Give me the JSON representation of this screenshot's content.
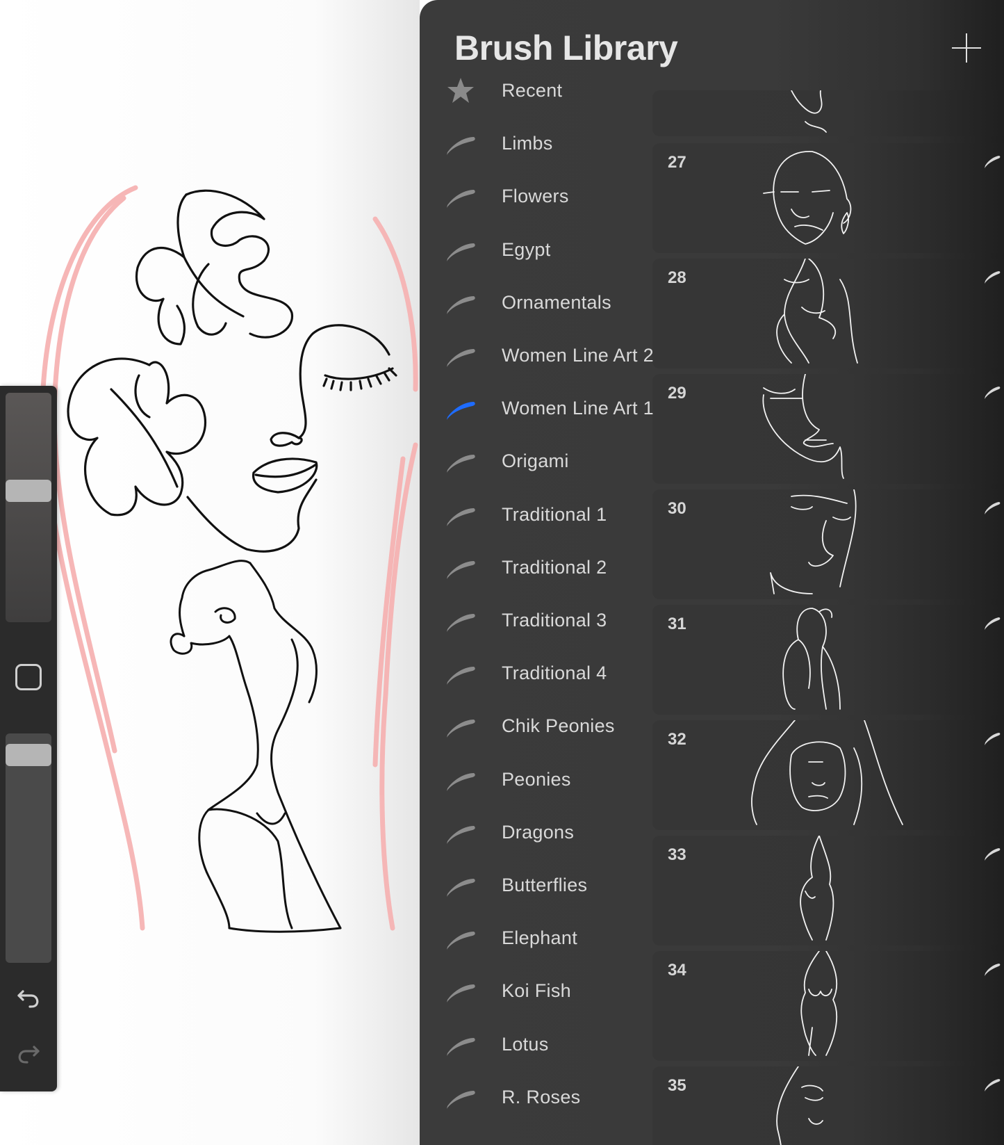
{
  "panel": {
    "title": "Brush Library",
    "add_icon": "plus-icon"
  },
  "sidebar": {
    "size_slider_level": 0.58,
    "opacity_slider_level": 0.95,
    "modify_icon": "square-icon",
    "undo_icon": "undo-arrow-icon",
    "redo_icon": "redo-arrow-icon"
  },
  "brush_sets": [
    {
      "label": "Recent",
      "icon": "star-icon",
      "selected": false
    },
    {
      "label": "Limbs",
      "icon": "brush-stroke-icon",
      "selected": false
    },
    {
      "label": "Flowers",
      "icon": "brush-stroke-icon",
      "selected": false
    },
    {
      "label": "Egypt",
      "icon": "brush-stroke-icon",
      "selected": false
    },
    {
      "label": "Ornamentals",
      "icon": "brush-stroke-icon",
      "selected": false
    },
    {
      "label": "Women Line Art 2",
      "icon": "brush-stroke-icon",
      "selected": false
    },
    {
      "label": "Women Line Art 1",
      "icon": "brush-stroke-icon",
      "selected": true
    },
    {
      "label": "Origami",
      "icon": "brush-stroke-icon",
      "selected": false
    },
    {
      "label": "Traditional 1",
      "icon": "brush-stroke-icon",
      "selected": false
    },
    {
      "label": "Traditional 2",
      "icon": "brush-stroke-icon",
      "selected": false
    },
    {
      "label": "Traditional 3",
      "icon": "brush-stroke-icon",
      "selected": false
    },
    {
      "label": "Traditional 4",
      "icon": "brush-stroke-icon",
      "selected": false
    },
    {
      "label": "Chik Peonies",
      "icon": "brush-stroke-icon",
      "selected": false
    },
    {
      "label": "Peonies",
      "icon": "brush-stroke-icon",
      "selected": false
    },
    {
      "label": "Dragons",
      "icon": "brush-stroke-icon",
      "selected": false
    },
    {
      "label": "Butterflies",
      "icon": "brush-stroke-icon",
      "selected": false
    },
    {
      "label": "Elephant",
      "icon": "brush-stroke-icon",
      "selected": false
    },
    {
      "label": "Koi Fish",
      "icon": "brush-stroke-icon",
      "selected": false
    },
    {
      "label": "Lotus",
      "icon": "brush-stroke-icon",
      "selected": false
    },
    {
      "label": "R. Roses",
      "icon": "brush-stroke-icon",
      "selected": false
    }
  ],
  "brushes": [
    {
      "number": "",
      "preview": "face-line-art-preview"
    },
    {
      "number": "27",
      "preview": "face-line-art-preview"
    },
    {
      "number": "28",
      "preview": "face-line-art-preview"
    },
    {
      "number": "29",
      "preview": "face-line-art-preview"
    },
    {
      "number": "30",
      "preview": "face-line-art-preview"
    },
    {
      "number": "31",
      "preview": "figure-line-art-preview"
    },
    {
      "number": "32",
      "preview": "face-line-art-preview"
    },
    {
      "number": "33",
      "preview": "figure-line-art-preview"
    },
    {
      "number": "34",
      "preview": "figure-line-art-preview"
    },
    {
      "number": "35",
      "preview": "face-line-art-preview"
    }
  ],
  "colors": {
    "accent": "#1e6cff",
    "panel_bg": "#3a3a3a",
    "card_bg": "#353535",
    "text": "#d9d9d9",
    "sketch_pink": "#f6b3b3"
  }
}
